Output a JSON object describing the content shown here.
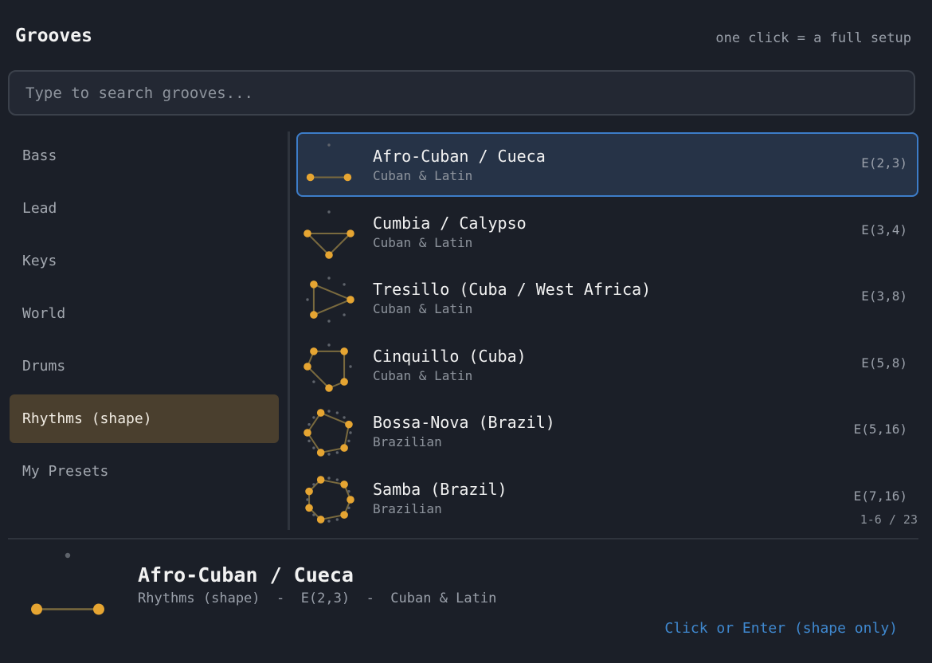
{
  "header": {
    "title": "Grooves",
    "hint": "one click = a full setup"
  },
  "search": {
    "placeholder": "Type to search grooves..."
  },
  "sidebar": {
    "items": [
      {
        "label": "Bass"
      },
      {
        "label": "Lead"
      },
      {
        "label": "Keys"
      },
      {
        "label": "World"
      },
      {
        "label": "Drums"
      },
      {
        "label": "Rhythms (shape)"
      },
      {
        "label": "My Presets"
      }
    ],
    "active_index": 5
  },
  "list": {
    "rows": [
      {
        "title": "Afro-Cuban / Cueca",
        "subtitle": "Cuban & Latin",
        "code": "E(2,3)",
        "pulses": 2,
        "steps": 3
      },
      {
        "title": "Cumbia / Calypso",
        "subtitle": "Cuban & Latin",
        "code": "E(3,4)",
        "pulses": 3,
        "steps": 4
      },
      {
        "title": "Tresillo (Cuba / West Africa)",
        "subtitle": "Cuban & Latin",
        "code": "E(3,8)",
        "pulses": 3,
        "steps": 8
      },
      {
        "title": "Cinquillo (Cuba)",
        "subtitle": "Cuban & Latin",
        "code": "E(5,8)",
        "pulses": 5,
        "steps": 8
      },
      {
        "title": "Bossa-Nova (Brazil)",
        "subtitle": "Brazilian",
        "code": "E(5,16)",
        "pulses": 5,
        "steps": 16
      },
      {
        "title": "Samba (Brazil)",
        "subtitle": "Brazilian",
        "code": "E(7,16)",
        "pulses": 7,
        "steps": 16
      }
    ],
    "selected_index": 0,
    "pager": "1-6 / 23"
  },
  "detail": {
    "title": "Afro-Cuban / Cueca",
    "meta": "Rhythms (shape)  -  E(2,3)  -  Cuban & Latin",
    "action": "Click or Enter (shape only)",
    "pulses": 2,
    "steps": 3
  },
  "colors": {
    "accent": "#e6a532",
    "line": "#7a6a3e",
    "inactive_dot": "#5e636b",
    "selected_border": "#3d7dc9",
    "sidebar_active_bg": "#4a3f2e",
    "action_link": "#3f88cf"
  }
}
